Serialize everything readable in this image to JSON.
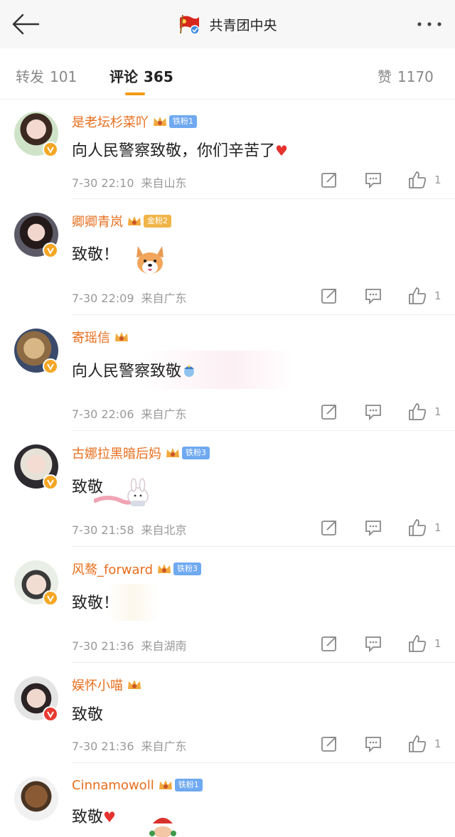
{
  "header": {
    "title": "共青团中央",
    "back_icon": "back-arrow-icon",
    "more_icon": "more-dots-icon"
  },
  "tabs": [
    {
      "label": "转发",
      "count": "101"
    },
    {
      "label": "评论",
      "count": "365"
    },
    {
      "label": "赞",
      "count": "1170"
    }
  ],
  "colors": {
    "accent": "#f39b13",
    "username": "#e86d1c",
    "meta": "#999999",
    "fan_blue": "#6fa9f0",
    "fan_gold": "#f0b548"
  },
  "comments": [
    {
      "user": "是老坛杉菜吖",
      "badge": "铁粉1",
      "text": "向人民警察致敬，你们辛苦了",
      "emoji": "heart",
      "time": "7-30 22:10",
      "location": "来自山东",
      "likes": "1"
    },
    {
      "user": "卿卿青岚",
      "badge": "金粉2",
      "text": "致敬！",
      "emoji": "corgi-sticker",
      "time": "7-30 22:09",
      "location": "来自广东",
      "likes": "1"
    },
    {
      "user": "寄瑶信",
      "badge": "",
      "text": "向人民警察致敬",
      "emoji": "salute-emoji",
      "time": "7-30 22:06",
      "location": "来自广东",
      "likes": "1"
    },
    {
      "user": "古娜拉黑暗后妈",
      "badge": "铁粉3",
      "text": "致敬",
      "emoji": "bunny-sticker",
      "time": "7-30 21:58",
      "location": "来自北京",
      "likes": "1"
    },
    {
      "user": "风骜_forward",
      "badge": "铁粉3",
      "text": "致敬！",
      "emoji": "",
      "time": "7-30 21:36",
      "location": "来自湖南",
      "likes": "1"
    },
    {
      "user": "娱怀小喵",
      "badge": "",
      "text": "致敬",
      "emoji": "",
      "time": "7-30 21:36",
      "location": "来自广东",
      "likes": "1"
    },
    {
      "user": "Cinnamowoll",
      "badge": "铁粉1",
      "text": "致敬",
      "emoji": "heart",
      "time": "",
      "location": "",
      "likes": ""
    }
  ]
}
